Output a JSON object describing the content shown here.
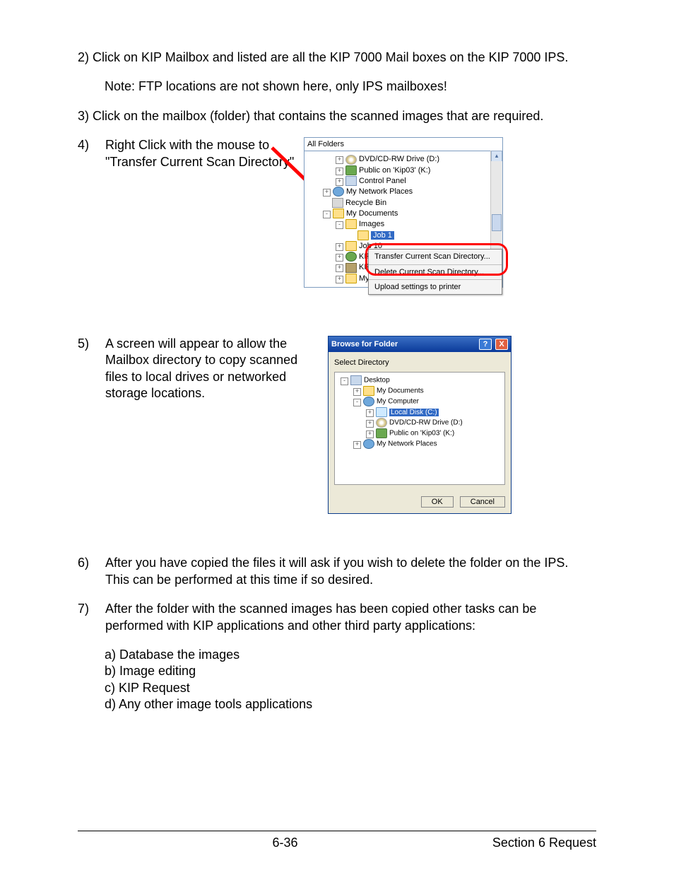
{
  "paragraphs": {
    "p2": "2)   Click on KIP Mailbox and listed are all the KIP 7000 Mail boxes on the KIP 7000 IPS.",
    "note": "Note:  FTP locations are not shown here, only IPS mailboxes!",
    "p3": "3)   Click on the mailbox (folder) that contains the scanned images that are required.",
    "p4num": "4)",
    "p4": "Right Click with the mouse to \"Transfer Current Scan Directory\"",
    "p5num": "5)",
    "p5": "A screen will appear to allow the Mailbox directory to copy scanned files to local drives or networked storage locations.",
    "p6num": "6)",
    "p6": "After you have copied the files it will ask if you wish to delete the folder on the IPS. This can be performed at this time if so desired.",
    "p7num": "7)",
    "p7": "After the folder with the scanned images has been copied other tasks can be performed with KIP applications and other third party applications:",
    "sa": "a) Database the images",
    "sb": "b) Image editing",
    "sc": "c) KIP Request",
    "sd": "d) Any other image tools applications"
  },
  "win1": {
    "title": "All Folders",
    "nodes": {
      "dvd": "DVD/CD-RW Drive (D:)",
      "public": "Public on 'Kip03' (K:)",
      "control": "Control Panel",
      "netplaces": "My Network Places",
      "recycle": "Recycle Bin",
      "mydocs": "My Documents",
      "images": "Images",
      "job1": "Job 1",
      "job10": "Job 10",
      "kip": "KIP",
      "kipf": "KIP F",
      "mymusic": "My Music"
    },
    "menu": {
      "transfer": "Transfer Current Scan Directory...",
      "delete": "Delete Current Scan Directory...",
      "upload": "Upload settings to printer"
    }
  },
  "win2": {
    "title": "Browse for Folder",
    "label": "Select Directory",
    "nodes": {
      "desktop": "Desktop",
      "mydocs": "My Documents",
      "mycomp": "My Computer",
      "localc": "Local Disk (C:)",
      "dvd": "DVD/CD-RW Drive (D:)",
      "public": "Public on 'Kip03' (K:)",
      "netplaces": "My Network Places"
    },
    "ok": "OK",
    "cancel": "Cancel"
  },
  "footer": {
    "page": "6-36",
    "section": "Section 6    Request"
  }
}
